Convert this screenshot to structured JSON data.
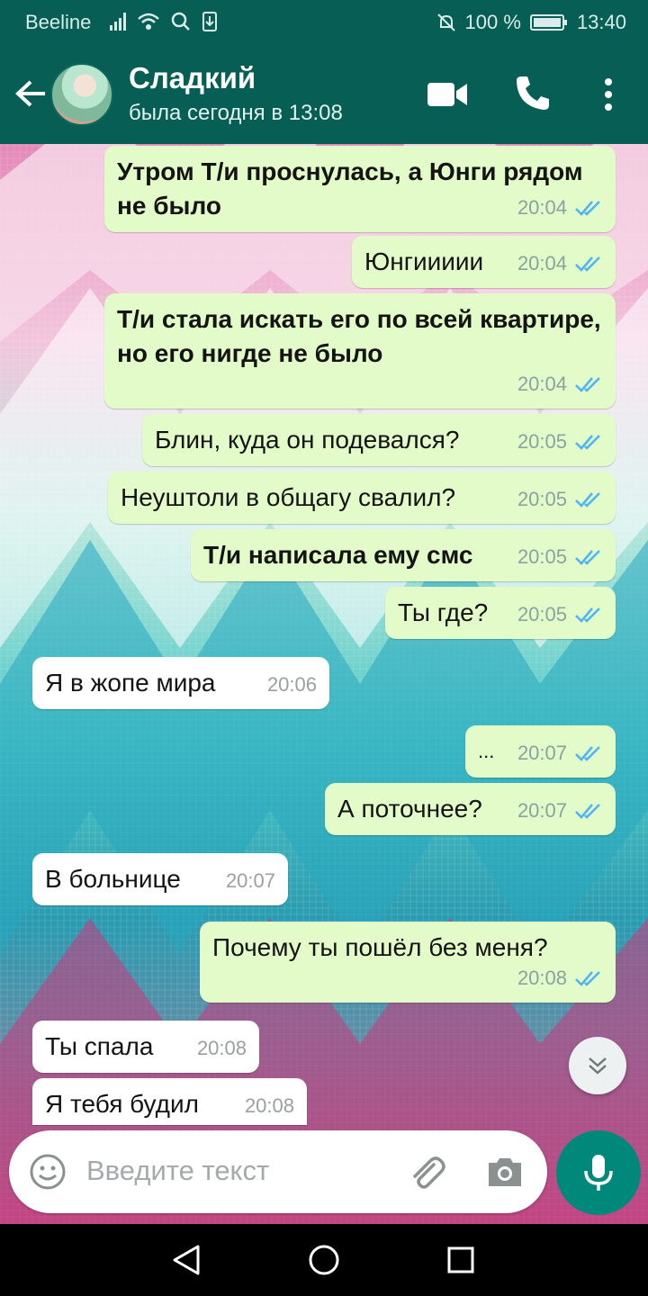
{
  "status_bar": {
    "carrier": "Beeline",
    "battery": "100 %",
    "time": "13:40"
  },
  "header": {
    "name": "Сладкий",
    "status": "была сегодня в 13:08"
  },
  "messages": [
    {
      "text": "Утром Т/и проснулась, а Юнги рядом не было",
      "time": "20:04"
    },
    {
      "text": "Юнгиииии",
      "time": "20:04"
    },
    {
      "text": "Т/и стала искать его по всей квартире, но его нигде не было",
      "time": "20:04"
    },
    {
      "text": "Блин, куда он подевался?",
      "time": "20:05"
    },
    {
      "text": "Неуштоли в общагу свалил?",
      "time": "20:05"
    },
    {
      "text": "Т/и написала ему смс",
      "time": "20:05"
    },
    {
      "text": "Ты где?",
      "time": "20:05"
    },
    {
      "text": "Я в жопе мира",
      "time": "20:06"
    },
    {
      "text": "...",
      "time": "20:07"
    },
    {
      "text": "А поточнее?",
      "time": "20:07"
    },
    {
      "text": "В больнице",
      "time": "20:07"
    },
    {
      "text": "Почему ты пошёл без меня?",
      "time": "20:08"
    },
    {
      "text": "Ты спала",
      "time": "20:08"
    },
    {
      "text": "Я тебя будил",
      "time": "20:08"
    }
  ],
  "input": {
    "placeholder": "Введите текст"
  },
  "colors": {
    "header": "#075e54",
    "outgoing": "#e2fbc8",
    "incoming": "#ffffff",
    "ticks": "#4fb3f6",
    "mic": "#00897b"
  },
  "icons": [
    "back-arrow-icon",
    "video-call-icon",
    "phone-icon",
    "more-icon",
    "emoji-icon",
    "attach-icon",
    "camera-icon",
    "mic-icon",
    "chevron-down-icon"
  ]
}
